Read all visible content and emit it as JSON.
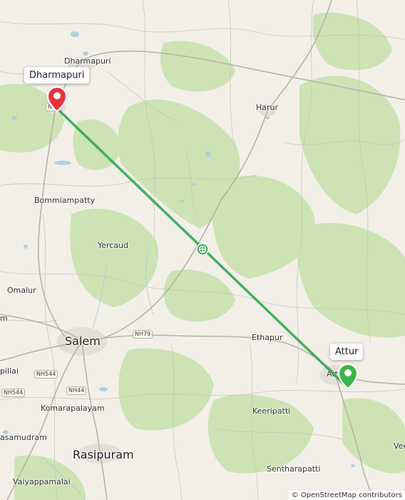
{
  "map": {
    "towns": {
      "dharmapuri": "Dharmapuri",
      "harur": "Harur",
      "bommiampatty": "Bommiampatty",
      "yercaud": "Yercaud",
      "omalur": "Omalur",
      "salem": "Salem",
      "ethapur": "Ethapur",
      "attur_partial": "Attu",
      "keeripatti": "Keeripatti",
      "komarapalayam": "Komarapalayam",
      "rasipuram": "Rasipuram",
      "sentharapatti": "Sentharapatti",
      "vaiyappamalai": "Vaiyappamalai",
      "samudram_partial": "asamudram",
      "pillai_partial": "pillai",
      "m_partial": "m",
      "vee_partial": "Vee"
    },
    "road_shields": {
      "nh79": "NH79",
      "nh544_a": "NH544",
      "nh544_b": "NH544",
      "nh44": "NH44",
      "nh_start": "NH4"
    },
    "start_marker": {
      "label": "Dharmapuri",
      "color": "#e8323a",
      "icon": "map-pin-icon"
    },
    "end_marker": {
      "label": "Attur",
      "color": "#3bb54a",
      "icon": "map-pin-icon"
    },
    "route": {
      "color": "#34a853",
      "midpoint_icon": "route-midpoint-icon"
    },
    "attribution": "© OpenStreetMap contributors"
  }
}
